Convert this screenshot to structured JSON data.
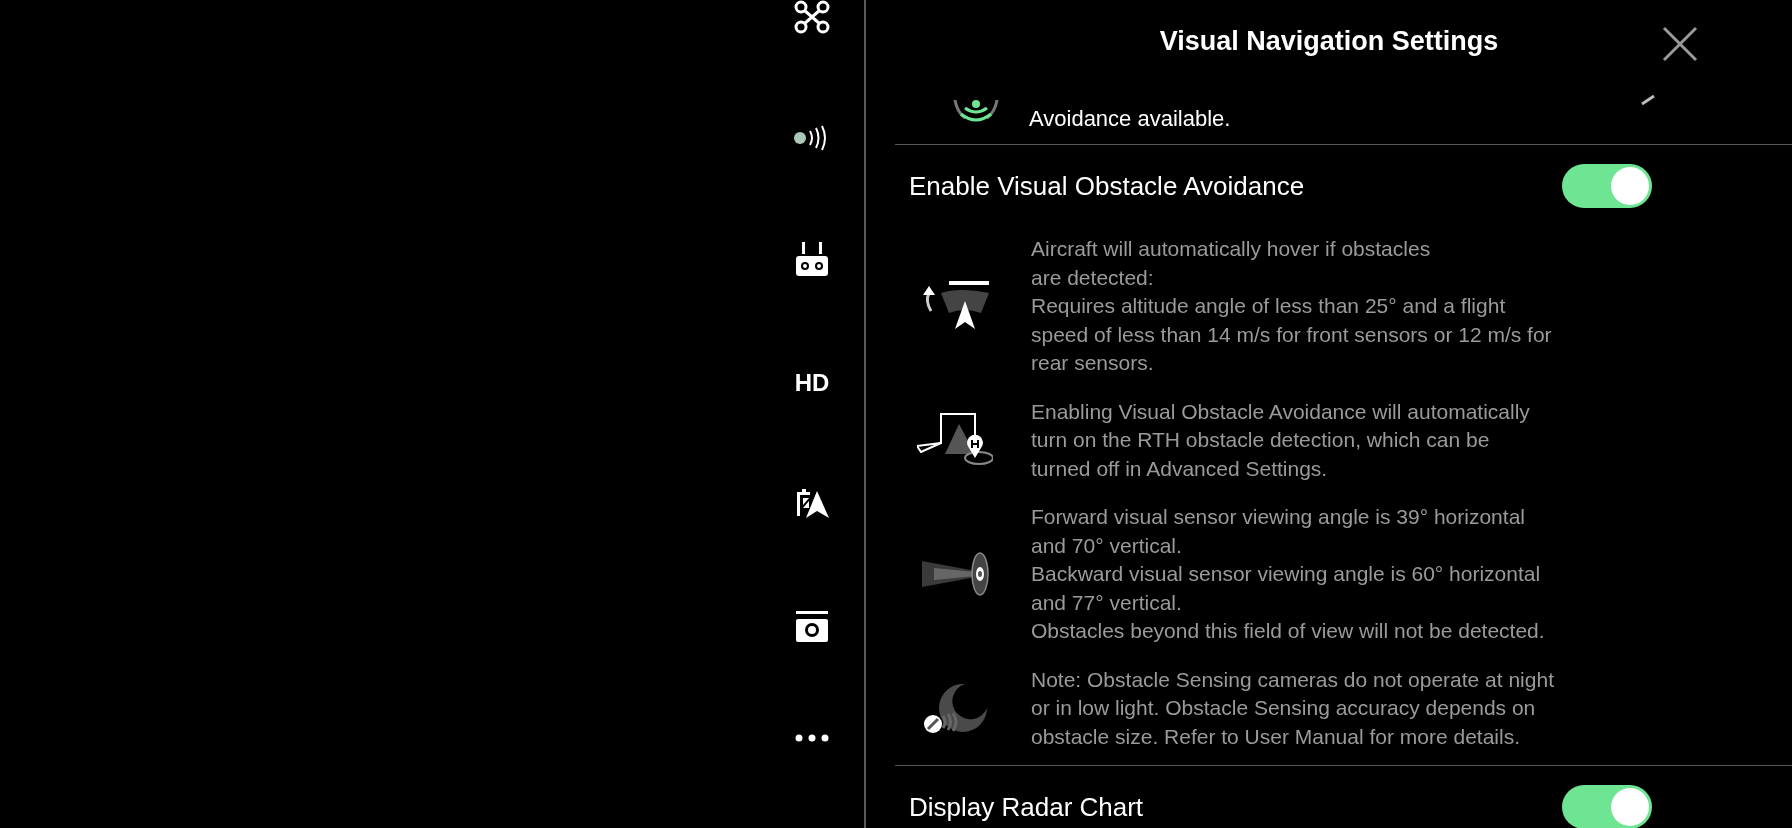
{
  "sidebar": {
    "items": [
      {
        "kind": "drone"
      },
      {
        "kind": "signal"
      },
      {
        "kind": "remote"
      },
      {
        "kind": "text",
        "label": "HD"
      },
      {
        "kind": "battery"
      },
      {
        "kind": "camera"
      },
      {
        "kind": "more"
      }
    ]
  },
  "panel": {
    "title": "Visual Navigation Settings",
    "partial_row": {
      "text": "Avoidance available."
    },
    "settings": [
      {
        "label": "Enable Visual Obstacle Avoidance",
        "on": true,
        "notes": [
          {
            "kind": "hover",
            "text": "Aircraft will automatically hover if obstacles\nare detected:\nRequires altitude angle of less than 25° and a flight\nspeed of less than 14 m/s for front sensors or 12 m/s for\nrear sensors."
          },
          {
            "kind": "rth",
            "text": "Enabling Visual Obstacle Avoidance will automatically\nturn on the RTH obstacle detection, which can be\nturned off in Advanced Settings."
          },
          {
            "kind": "sensor",
            "text": "Forward visual sensor viewing angle is 39° horizontal\nand 70° vertical.\nBackward visual sensor viewing angle is 60° horizontal\nand 77° vertical.\nObstacles beyond this field of view will not be detected."
          },
          {
            "kind": "night",
            "text": "Note: Obstacle Sensing cameras do not operate at night\nor in low light. Obstacle Sensing accuracy depends on\nobstacle size. Refer to User Manual for more details."
          }
        ]
      },
      {
        "label": "Display Radar Chart",
        "on": true
      }
    ]
  }
}
